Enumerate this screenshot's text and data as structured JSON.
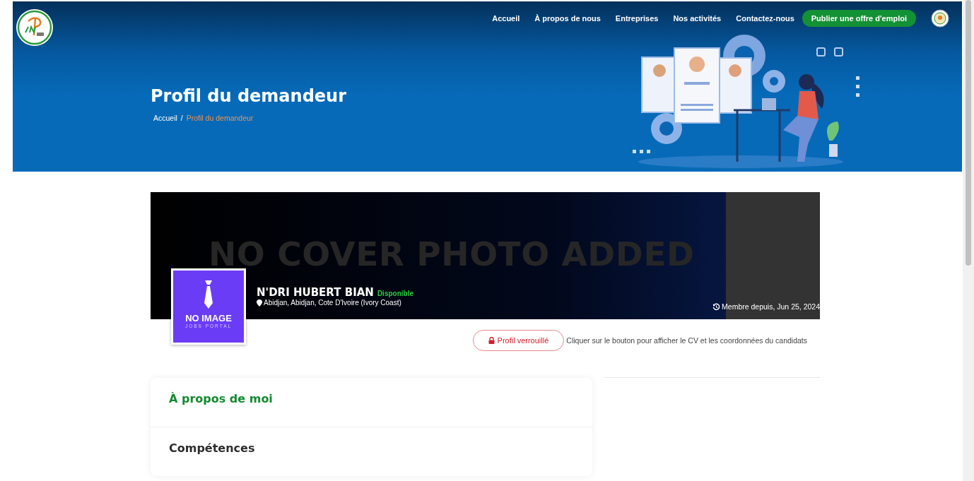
{
  "nav": {
    "links": [
      {
        "label": "Accueil"
      },
      {
        "label": "À propos de nous"
      },
      {
        "label": "Entreprises"
      },
      {
        "label": "Nos activités"
      },
      {
        "label": "Contactez-nous"
      }
    ],
    "cta": "Publier une offre d'emploi"
  },
  "hero": {
    "title": "Profil du demandeur",
    "breadcrumb_separator": "/",
    "breadcrumb": [
      {
        "label": "Accueil",
        "current": false
      },
      {
        "label": "Profil du demandeur",
        "current": true
      }
    ]
  },
  "profile": {
    "cover_text": "NO COVER PHOTO ADDED",
    "avatar_text": "NO IMAGE",
    "avatar_subtext": "JOBS PORTAL",
    "name": "N'DRI HUBERT BIAN",
    "status": "Disponible",
    "location": "Abidjan, Abidjan, Cote D'Ivoire (Ivory Coast)",
    "member_since": "Membre depuis, Jun 25, 2024",
    "locked_button": "Profil verrouillé",
    "hint": "Cliquer sur le bouton pour afficher le CV et les coordonnées du candidats"
  },
  "sections": [
    {
      "kind": "about",
      "title": "À propos de moi"
    },
    {
      "kind": "skills",
      "title": "Compétences"
    }
  ]
}
